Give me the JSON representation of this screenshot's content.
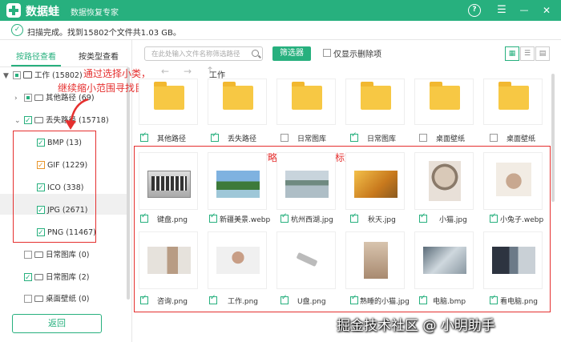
{
  "app": {
    "title": "数据蛙",
    "subtitle": "数据恢复专家",
    "window_buttons": {
      "help": "?",
      "menu": "☰",
      "minimize": "—",
      "close": "✕"
    },
    "brand_color": "#27b07e"
  },
  "status": {
    "text": "扫描完成。找到15802个文件共1.03 GB。"
  },
  "tabs": {
    "by_path": "按路径查看",
    "by_type": "按类型查看"
  },
  "tree": {
    "root": "工作 (15802)",
    "other_paths": "其他路径 (69)",
    "lost_paths": "丢失路径 (15718)",
    "types": [
      {
        "label": "BMP (13)"
      },
      {
        "label": "GIF (1229)"
      },
      {
        "label": "ICO (338)"
      },
      {
        "label": "JPG (2671)"
      },
      {
        "label": "PNG (11467)"
      }
    ],
    "after": [
      {
        "label": "日常图库 (0)"
      },
      {
        "label": "日常图库 (2)"
      },
      {
        "label": "桌面壁纸 (0)"
      }
    ]
  },
  "annotations": {
    "line1": "通过选择小类，",
    "line2": "继续缩小范围寻找目标文件",
    "files_note": "可以根据缩略图尝试找到目标文件"
  },
  "toolbar": {
    "search_placeholder": "在此处输入文件名称筛选路径",
    "filter_button": "筛选器",
    "show_deleted": "仅显示删除项",
    "path": "工作"
  },
  "folders": [
    {
      "label": "其他路径"
    },
    {
      "label": "丢失路径"
    },
    {
      "label": "日常图库"
    },
    {
      "label": "日常图库"
    },
    {
      "label": "桌面壁纸"
    },
    {
      "label": "桌面壁纸"
    }
  ],
  "files_row1": [
    {
      "label": "键盘.png"
    },
    {
      "label": "新疆美景.webp"
    },
    {
      "label": "杭州西湖.jpg"
    },
    {
      "label": "秋天.jpg"
    },
    {
      "label": "小猫.jpg"
    },
    {
      "label": "小兔子.webp"
    }
  ],
  "files_row2": [
    {
      "label": "咨询.png"
    },
    {
      "label": "工作.png"
    },
    {
      "label": "U盘.png"
    },
    {
      "label": "熟睡的小猫.jpg"
    },
    {
      "label": "电脑.bmp"
    },
    {
      "label": "看电脑.png"
    }
  ],
  "buttons": {
    "back": "返回"
  },
  "watermark": "掘金技术社区 @ 小明助手"
}
